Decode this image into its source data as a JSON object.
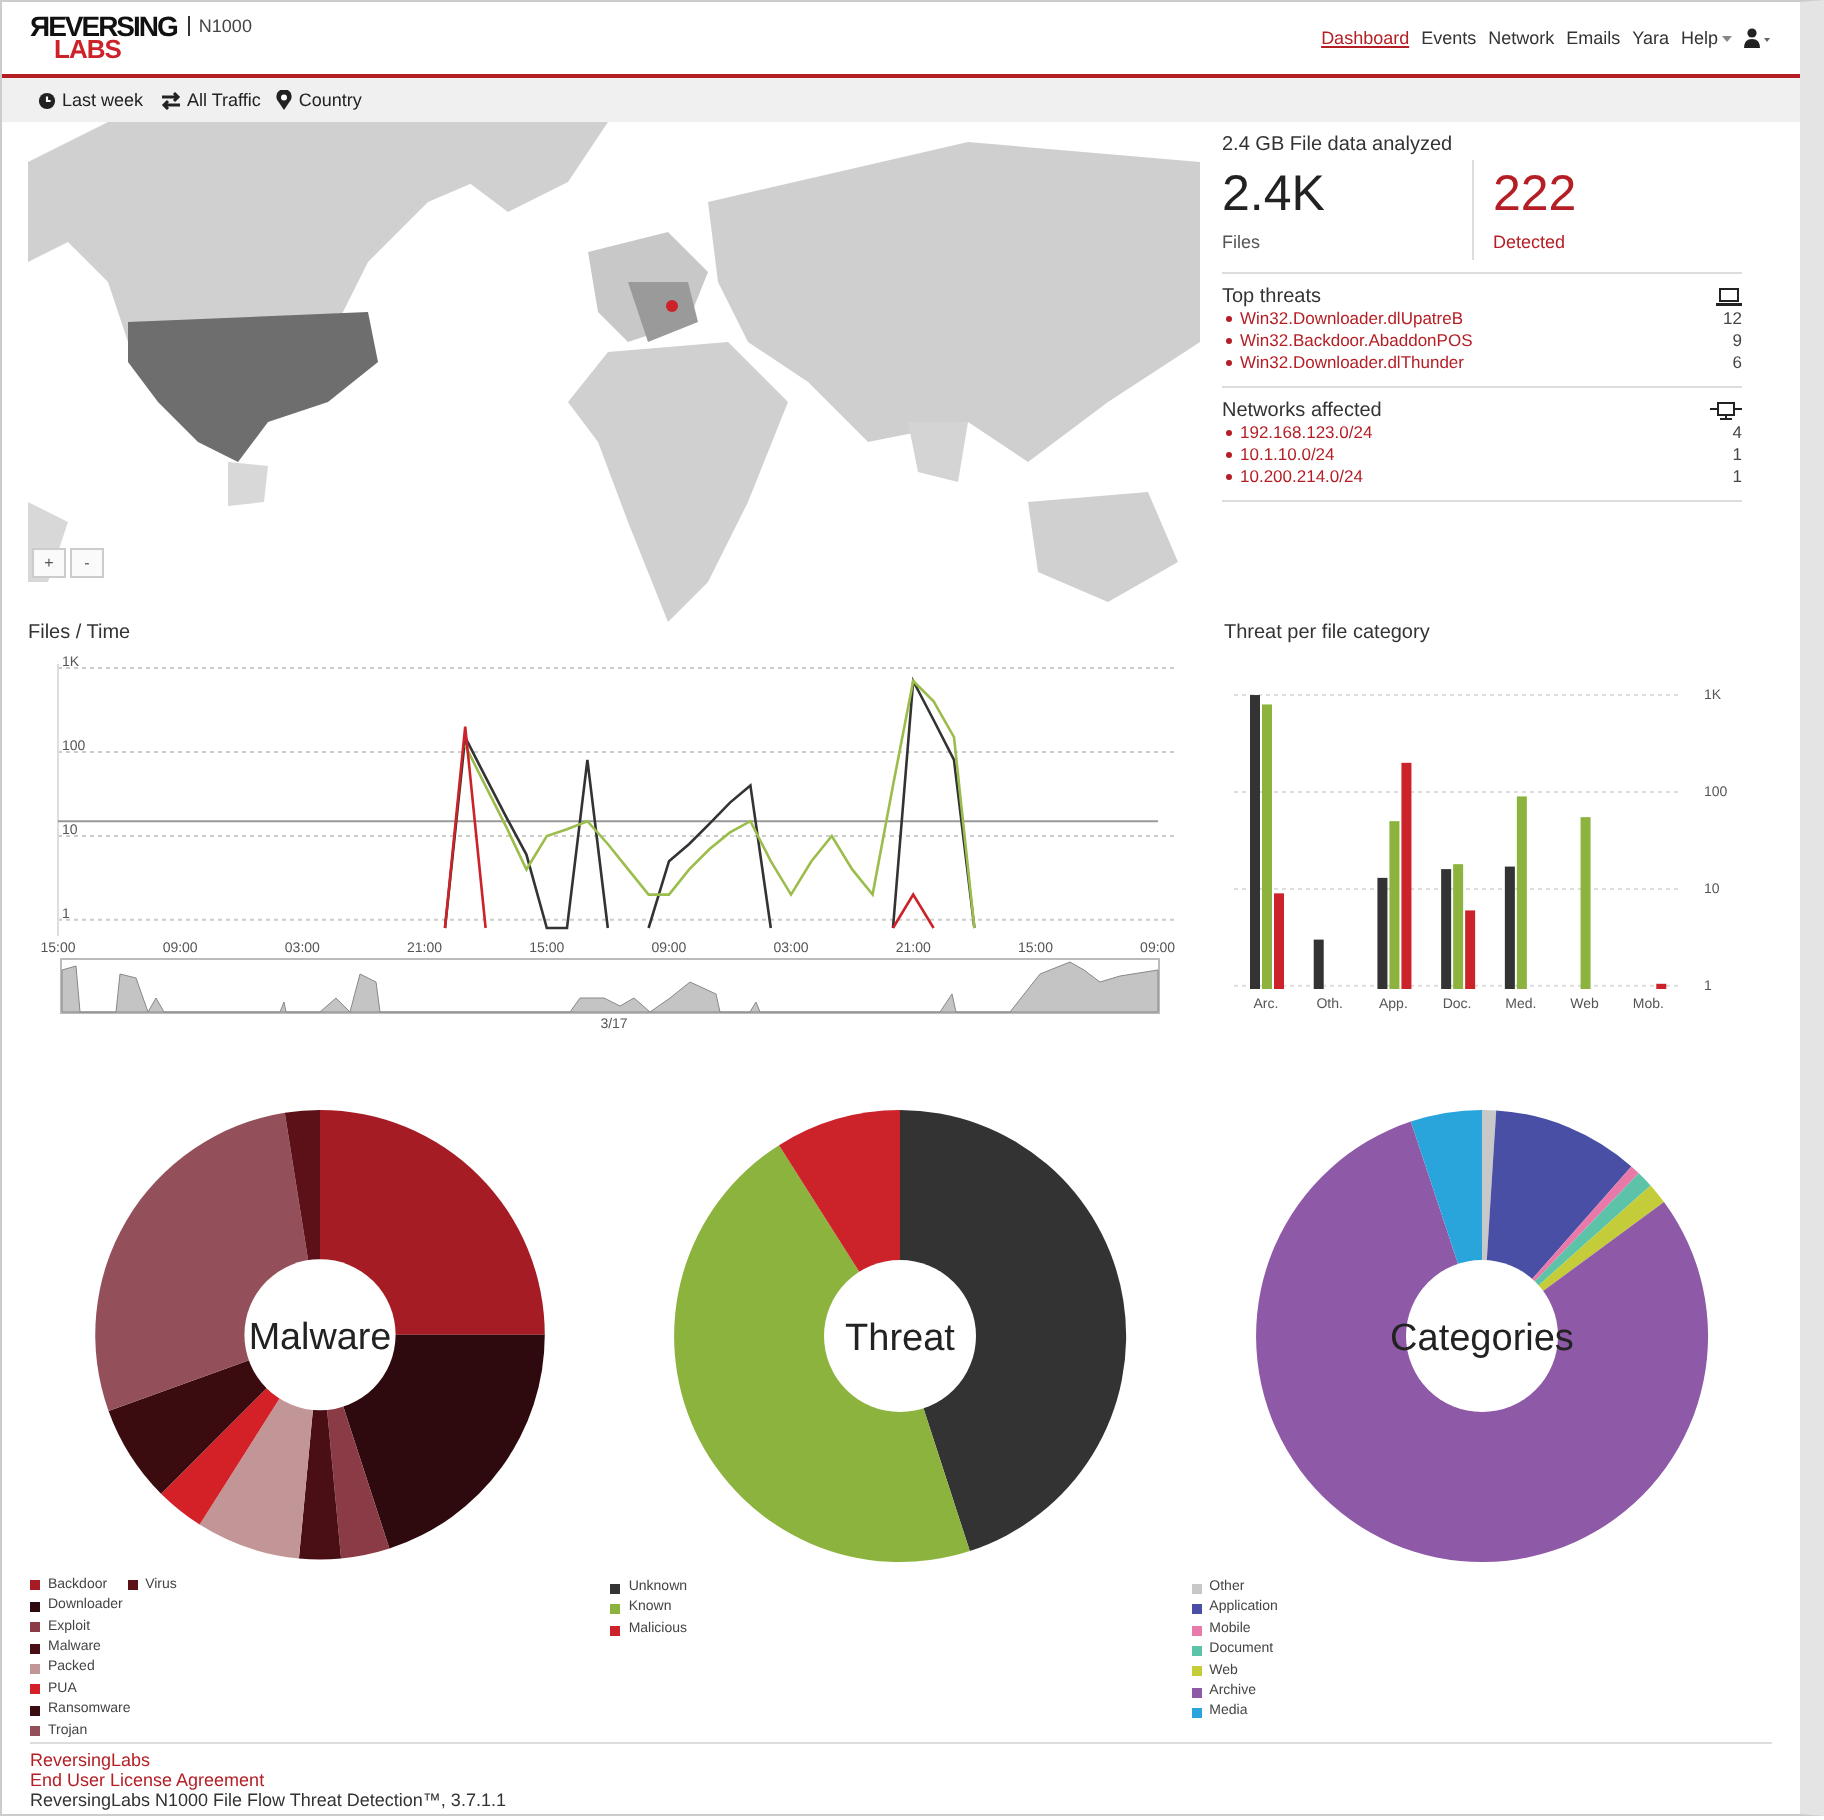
{
  "header": {
    "logo_top": "ЯEVERSING",
    "logo_bottom": "LABS",
    "product": "N1000",
    "nav": [
      {
        "label": "Dashboard",
        "selected": true
      },
      {
        "label": "Events",
        "selected": false
      },
      {
        "label": "Network",
        "selected": false
      },
      {
        "label": "Emails",
        "selected": false
      },
      {
        "label": "Yara",
        "selected": false
      },
      {
        "label": "Help",
        "selected": false,
        "dropdown": true
      }
    ]
  },
  "filters": [
    {
      "kind": "clock",
      "label": "Last week"
    },
    {
      "kind": "arrows",
      "label": "All Traffic"
    },
    {
      "kind": "pin",
      "label": "Country"
    }
  ],
  "map": {
    "zoom_in": "+",
    "zoom_out": "-"
  },
  "summary": {
    "title": "2.4 GB File data analyzed",
    "files": {
      "value": "2.4K",
      "label": "Files"
    },
    "detected": {
      "value": "222",
      "label": "Detected"
    }
  },
  "top_threats": {
    "title": "Top threats",
    "items": [
      {
        "name": "Win32.Downloader.dlUpatreB",
        "count": "12"
      },
      {
        "name": "Win32.Backdoor.AbaddonPOS",
        "count": "9"
      },
      {
        "name": "Win32.Downloader.dlThunder",
        "count": "6"
      }
    ]
  },
  "networks": {
    "title": "Networks affected",
    "items": [
      {
        "name": "192.168.123.0/24",
        "count": "4"
      },
      {
        "name": "10.1.10.0/24",
        "count": "1"
      },
      {
        "name": "10.200.214.0/24",
        "count": "1"
      }
    ]
  },
  "files_time": {
    "title": "Files / Time",
    "overview_label": "3/17",
    "y_labels": [
      "1K",
      "100",
      "10",
      "1"
    ],
    "x_labels": [
      "15:00",
      "09:00",
      "03:00",
      "21:00",
      "15:00",
      "09:00",
      "03:00",
      "21:00",
      "15:00",
      "09:00"
    ]
  },
  "threat_category": {
    "title": "Threat per file category",
    "y_labels": [
      "1K",
      "100",
      "10",
      "1"
    ],
    "categories": [
      "Arc.",
      "Oth.",
      "App.",
      "Doc.",
      "Med.",
      "Web",
      "Mob."
    ]
  },
  "pies": [
    {
      "label": "Malware",
      "legend_rows": [
        [
          {
            "name": "Backdoor",
            "color": "#a51c24"
          },
          {
            "name": "Virus",
            "color": "#5c1018"
          }
        ],
        [
          {
            "name": "Downloader",
            "color": "#2e0a0e"
          }
        ],
        [
          {
            "name": "Exploit",
            "color": "#8a3b45"
          }
        ],
        [
          {
            "name": "Malware",
            "color": "#4a0f15"
          }
        ],
        [
          {
            "name": "Packed",
            "color": "#c29597"
          }
        ],
        [
          {
            "name": "PUA",
            "color": "#d42027"
          }
        ],
        [
          {
            "name": "Ransomware",
            "color": "#3a0c10"
          }
        ],
        [
          {
            "name": "Trojan",
            "color": "#94505a"
          }
        ]
      ]
    },
    {
      "label": "Threat",
      "legend_rows": [
        [
          {
            "name": "Unknown",
            "color": "#333333"
          }
        ],
        [
          {
            "name": "Known",
            "color": "#8db33f"
          }
        ],
        [
          {
            "name": "Malicious",
            "color": "#cc2229"
          }
        ]
      ]
    },
    {
      "label": "Categories",
      "legend_rows": [
        [
          {
            "name": "Other",
            "color": "#c8c8c8"
          }
        ],
        [
          {
            "name": "Application",
            "color": "#4a4fa6"
          }
        ],
        [
          {
            "name": "Mobile",
            "color": "#e879a8"
          }
        ],
        [
          {
            "name": "Document",
            "color": "#5cc3a8"
          }
        ],
        [
          {
            "name": "Web",
            "color": "#c4cc3a"
          }
        ],
        [
          {
            "name": "Archive",
            "color": "#8e5aa8"
          }
        ],
        [
          {
            "name": "Media",
            "color": "#2aa5dc"
          }
        ]
      ]
    }
  ],
  "footer": {
    "links": [
      "ReversingLabs",
      "End User License Agreement"
    ],
    "text": "ReversingLabs N1000 File Flow Threat Detection™, 3.7.1.1"
  }
}
